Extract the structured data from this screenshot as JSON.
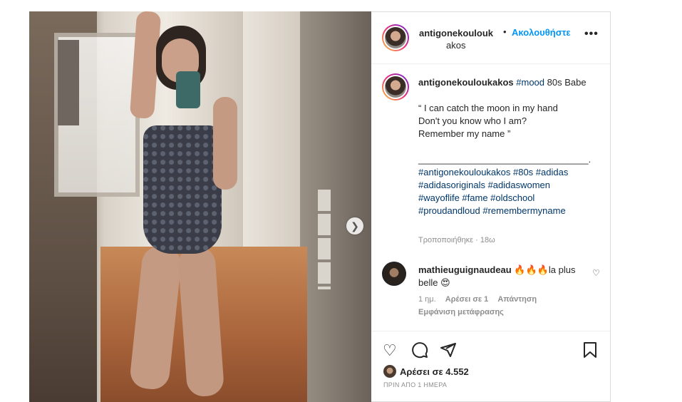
{
  "post": {
    "image_alt": "mirror selfie in swimsuit",
    "next_button_icon": "chevron-right-icon"
  },
  "header": {
    "username_line1": "antigonekoulouk",
    "username_line2": "akos",
    "separator": "•",
    "follow_label": "Ακολουθήστε",
    "more_icon": "•••"
  },
  "caption": {
    "username": "antigonekouloukakos",
    "line1_tag": "#mood",
    "line1_text": " 80s Babe",
    "quote1": "“ I can catch the moon in my hand",
    "quote2": "Don't you know who I am?",
    "quote3": "Remember my name ”",
    "divider": "_________________________________.",
    "tags": "#antigonekouloukakos #80s #adidas #adidasoriginals #adidaswomen #wayoflife #fame #oldschool #proudandloud #remembermyname",
    "edited": "Τροποποιήθηκε · 18ω"
  },
  "comment": {
    "username": "mathieuguignaudeau",
    "text": " 🔥🔥🔥la plus belle 😍",
    "time": "1 ημ.",
    "likes": "Αρέσει σε 1",
    "reply": "Απάντηση",
    "translation": "Εμφάνιση μετάφρασης"
  },
  "actions": {
    "likes_text": "Αρέσει σε 4.552",
    "date": "ΠΡΙΝ ΑΠΟ 1 ΗΜΕΡΑ"
  }
}
